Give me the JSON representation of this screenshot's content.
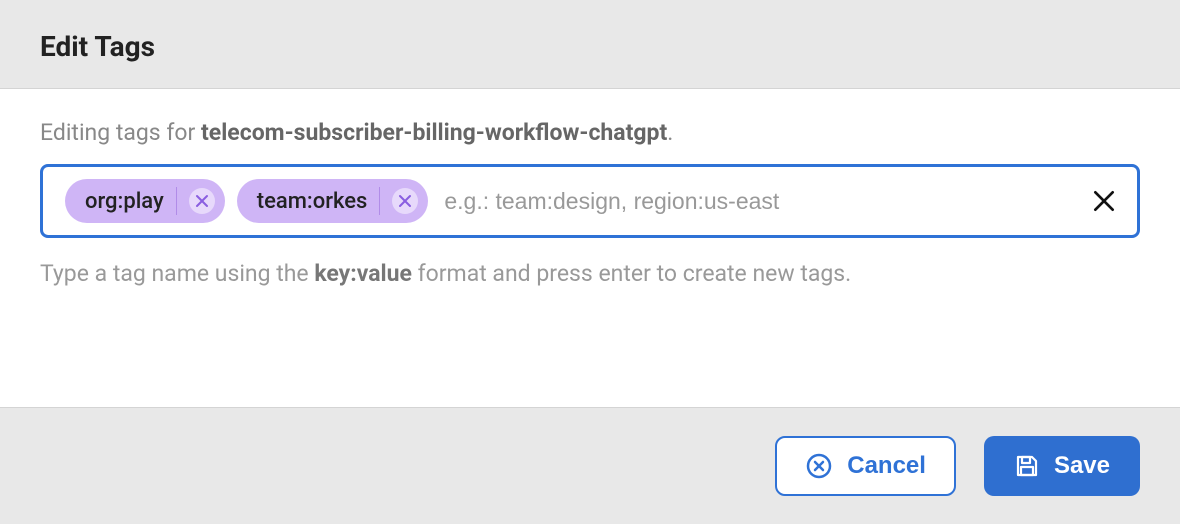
{
  "header": {
    "title": "Edit Tags"
  },
  "editing": {
    "prefix": "Editing tags for ",
    "workflow_name": "telecom-subscriber-billing-workflow-chatgpt",
    "suffix": "."
  },
  "tags": [
    {
      "label": "org:play"
    },
    {
      "label": "team:orkes"
    }
  ],
  "input": {
    "placeholder": "e.g.: team:design, region:us-east"
  },
  "help": {
    "before": "Type a tag name using the ",
    "bold": "key:value",
    "after": " format and press enter to create new tags."
  },
  "footer": {
    "cancel": "Cancel",
    "save": "Save"
  }
}
